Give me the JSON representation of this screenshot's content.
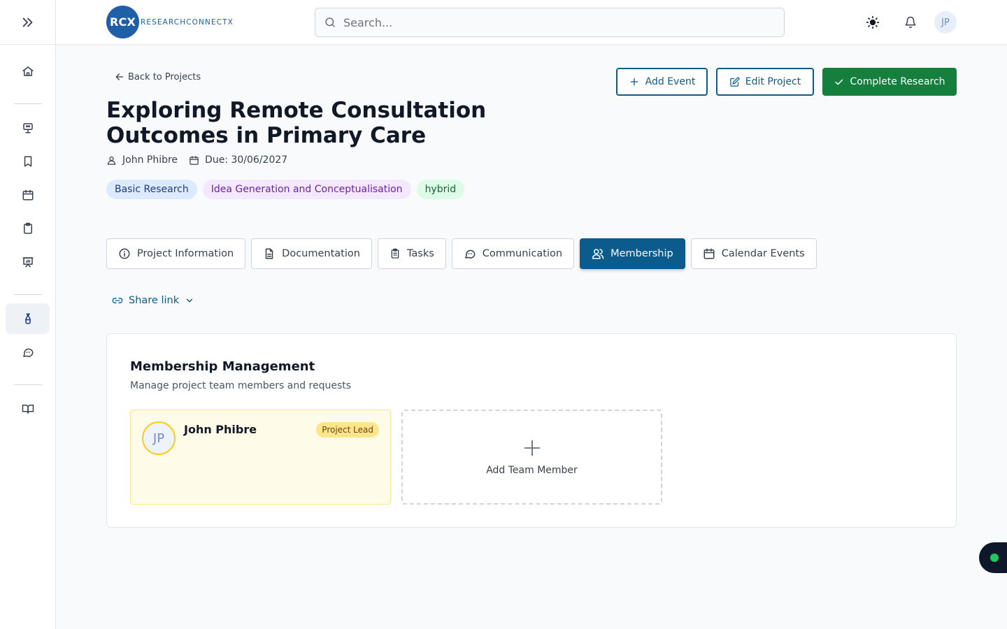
{
  "header": {
    "logo_badge": "RCX",
    "logo_text": "RESEARCHCONNECTX",
    "search_placeholder": "Search...",
    "avatar_initials": "JP"
  },
  "sidebar": {
    "items": [
      {
        "icon": "home-icon"
      },
      {
        "icon": "presentation-icon"
      },
      {
        "icon": "bookmark-icon"
      },
      {
        "icon": "calendar-icon"
      },
      {
        "icon": "clipboard-icon"
      },
      {
        "icon": "chart-board-icon"
      },
      {
        "icon": "flask-icon",
        "active": true
      },
      {
        "icon": "chat-icon"
      },
      {
        "icon": "book-icon"
      }
    ]
  },
  "project": {
    "back_label": "Back to Projects",
    "title": "Exploring Remote Consultation Outcomes in Primary Care",
    "owner": "John Phibre",
    "due": "Due: 30/06/2027",
    "tags": [
      "Basic Research",
      "Idea Generation and Conceptualisation",
      "hybrid"
    ]
  },
  "actions": {
    "add_event": "Add Event",
    "edit_project": "Edit Project",
    "complete_research": "Complete Research"
  },
  "tabs": [
    {
      "label": "Project Information",
      "icon": "info-icon"
    },
    {
      "label": "Documentation",
      "icon": "document-icon"
    },
    {
      "label": "Tasks",
      "icon": "clipboard-icon"
    },
    {
      "label": "Communication",
      "icon": "chat-icon"
    },
    {
      "label": "Membership",
      "icon": "users-icon",
      "active": true
    },
    {
      "label": "Calendar Events",
      "icon": "calendar-icon"
    }
  ],
  "share_link": "Share link",
  "membership": {
    "title": "Membership Management",
    "subtitle": "Manage project team members and requests",
    "members": [
      {
        "initials": "JP",
        "name": "John Phibre",
        "role": "Project Lead"
      }
    ],
    "add_label": "Add Team Member"
  },
  "colors": {
    "primary": "#0b5b8c",
    "success": "#15803d",
    "lead_bg": "#fefce8"
  }
}
